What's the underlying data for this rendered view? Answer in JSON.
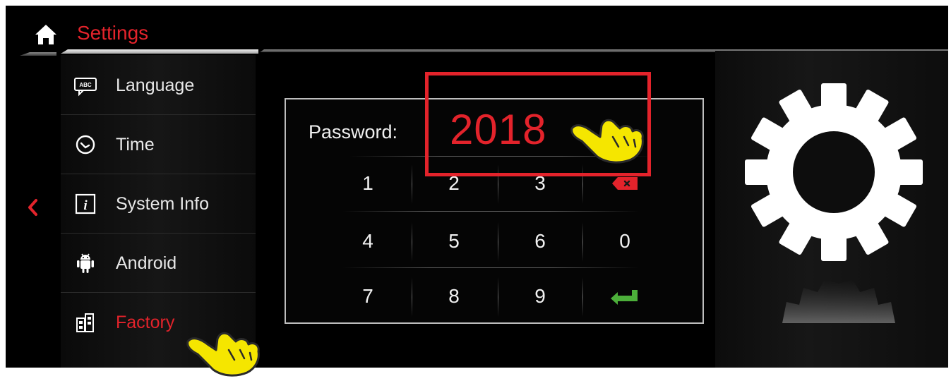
{
  "header": {
    "title": "Settings",
    "home_icon": "home-icon",
    "back_icon": "chevron-left-icon"
  },
  "sidebar": {
    "items": [
      {
        "label": "Language",
        "icon": "keyboard-abc-icon"
      },
      {
        "label": "Time",
        "icon": "clock-icon"
      },
      {
        "label": "System Info",
        "icon": "info-icon"
      },
      {
        "label": "Android",
        "icon": "android-icon"
      },
      {
        "label": "Factory",
        "icon": "factory-icon",
        "active": true
      }
    ]
  },
  "password_dialog": {
    "label": "Password:",
    "value": "2018",
    "keys": {
      "k1": "1",
      "k2": "2",
      "k3": "3",
      "k4": "4",
      "k5": "5",
      "k6": "6",
      "k0": "0",
      "k7": "7",
      "k8": "8",
      "k9": "9"
    },
    "backspace_icon": "backspace-icon",
    "enter_icon": "enter-arrow-icon"
  },
  "right_panel": {
    "icon": "gear-icon"
  },
  "colors": {
    "accent": "#e3232b",
    "enter": "#4caf3a",
    "pointer": "#f5e600",
    "text": "#e8e8e8",
    "background": "#000000"
  }
}
